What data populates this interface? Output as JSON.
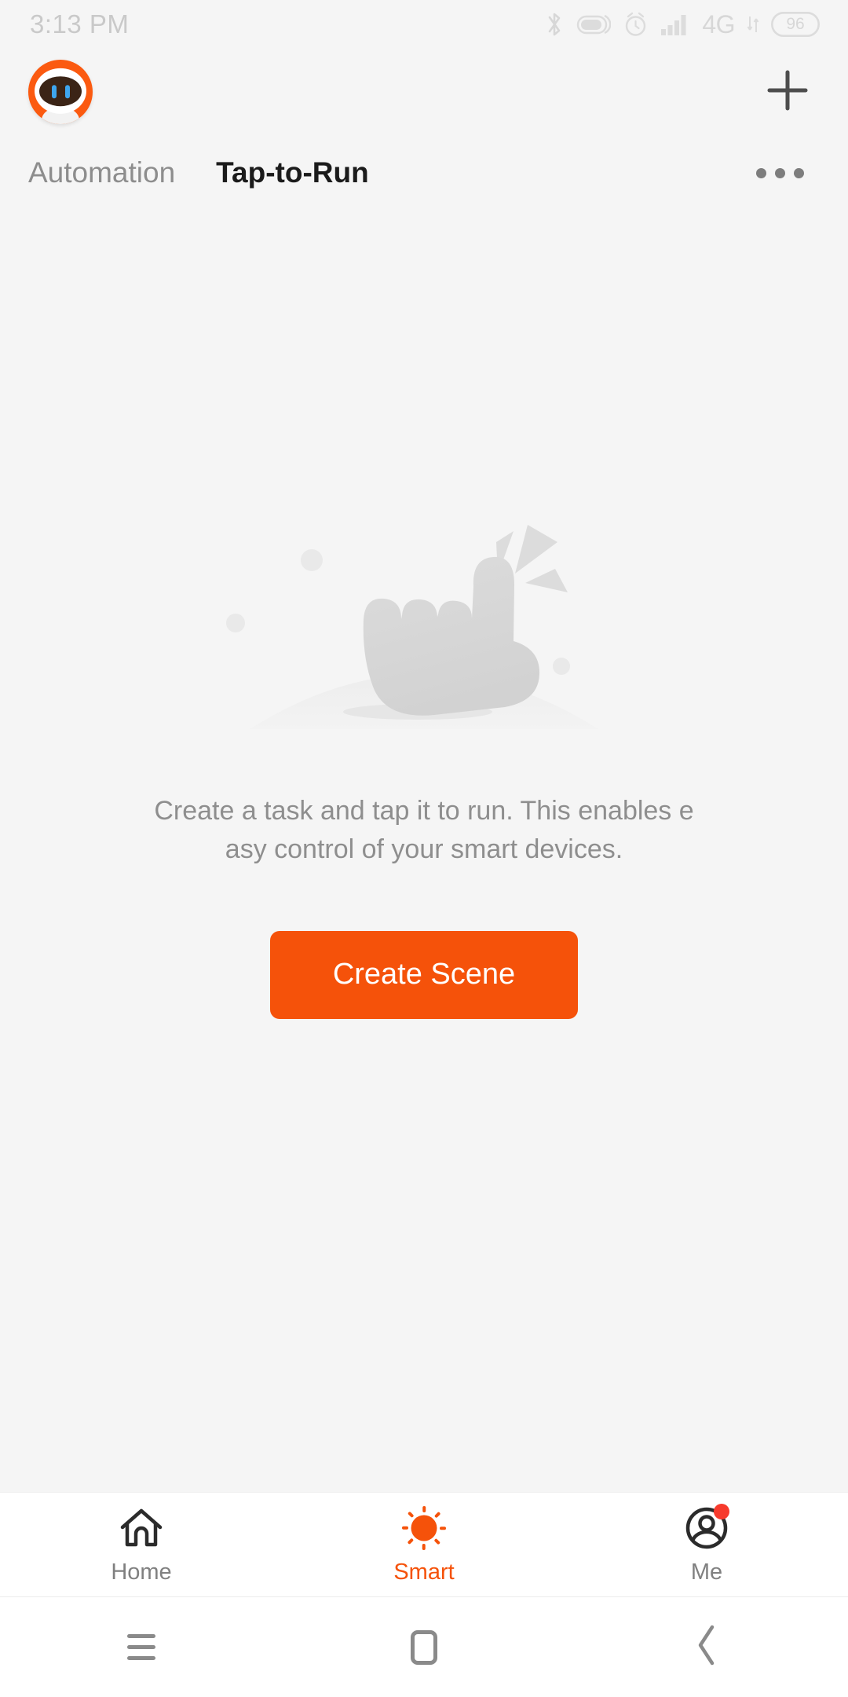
{
  "status_bar": {
    "time": "3:13 PM",
    "network_label": "4G",
    "battery_level": "96",
    "icons": [
      "bluetooth-icon",
      "vibrate-icon",
      "alarm-icon",
      "signal-icon",
      "network-4g-label",
      "data-transfer-icon",
      "battery-icon"
    ]
  },
  "app_bar": {
    "logo_name": "smart-life-logo",
    "add_label": "+"
  },
  "tabs": [
    {
      "label": "Automation",
      "active": false
    },
    {
      "label": "Tap-to-Run",
      "active": true
    }
  ],
  "overflow": {
    "label": "More options"
  },
  "empty_state": {
    "illustration": "tap-finger-illustration",
    "message": "Create a task and tap it to run. This enables easy control of your smart devices.",
    "cta_label": "Create Scene"
  },
  "bottom_nav": [
    {
      "label": "Home",
      "icon": "house-icon",
      "active": false,
      "badge": false
    },
    {
      "label": "Smart",
      "icon": "sun-icon",
      "active": true,
      "badge": false
    },
    {
      "label": "Me",
      "icon": "person-circle-icon",
      "active": false,
      "badge": true
    }
  ],
  "system_nav": [
    {
      "name": "recents-button",
      "icon": "hamburger-icon"
    },
    {
      "name": "home-button",
      "icon": "rounded-square-icon"
    },
    {
      "name": "back-button",
      "icon": "chevron-left-icon"
    }
  ],
  "colors": {
    "accent": "#f5520a",
    "background": "#f5f5f5",
    "surface": "#ffffff",
    "text_primary": "#1b1b1b",
    "text_secondary": "#8e8e8e",
    "badge": "#f73a2c"
  }
}
